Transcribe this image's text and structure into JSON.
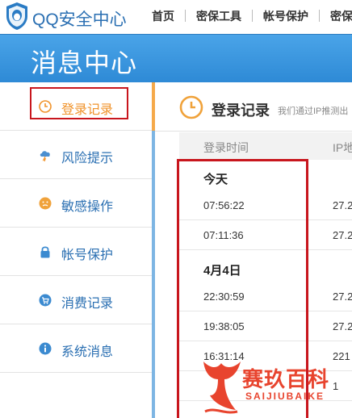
{
  "header": {
    "brand": "QQ安全中心",
    "nav": [
      "首页",
      "密保工具",
      "帐号保护",
      "密保"
    ]
  },
  "banner": {
    "title": "消息中心"
  },
  "sidebar": {
    "items": [
      {
        "label": "登录记录",
        "icon": "clock-icon",
        "active": true
      },
      {
        "label": "风险提示",
        "icon": "storm-cloud-icon",
        "active": false
      },
      {
        "label": "敏感操作",
        "icon": "face-icon",
        "active": false
      },
      {
        "label": "帐号保护",
        "icon": "lock-icon",
        "active": false
      },
      {
        "label": "消费记录",
        "icon": "cart-icon",
        "active": false
      },
      {
        "label": "系统消息",
        "icon": "info-icon",
        "active": false
      }
    ]
  },
  "main": {
    "title": "登录记录",
    "desc": "我们通过IP推测出",
    "columns": [
      "登录时间",
      "IP地"
    ],
    "groups": [
      {
        "day": "今天",
        "rows": [
          {
            "time": "07:56:22",
            "ip": "27.2"
          },
          {
            "time": "07:11:36",
            "ip": "27.2"
          }
        ]
      },
      {
        "day": "4月4日",
        "rows": [
          {
            "time": "22:30:59",
            "ip": "27.2"
          },
          {
            "time": "19:38:05",
            "ip": "27.2"
          },
          {
            "time": "16:31:14",
            "ip": "221"
          },
          {
            "time": "",
            "ip": "1"
          }
        ]
      }
    ]
  },
  "watermark": {
    "cn": "赛玖百科",
    "en": "SAIJIUBAIKE"
  },
  "colors": {
    "accent_blue": "#2a6fb2",
    "active_orange": "#f0932b",
    "highlight_red": "#c8161d",
    "banner_blue": "#3b95df"
  }
}
